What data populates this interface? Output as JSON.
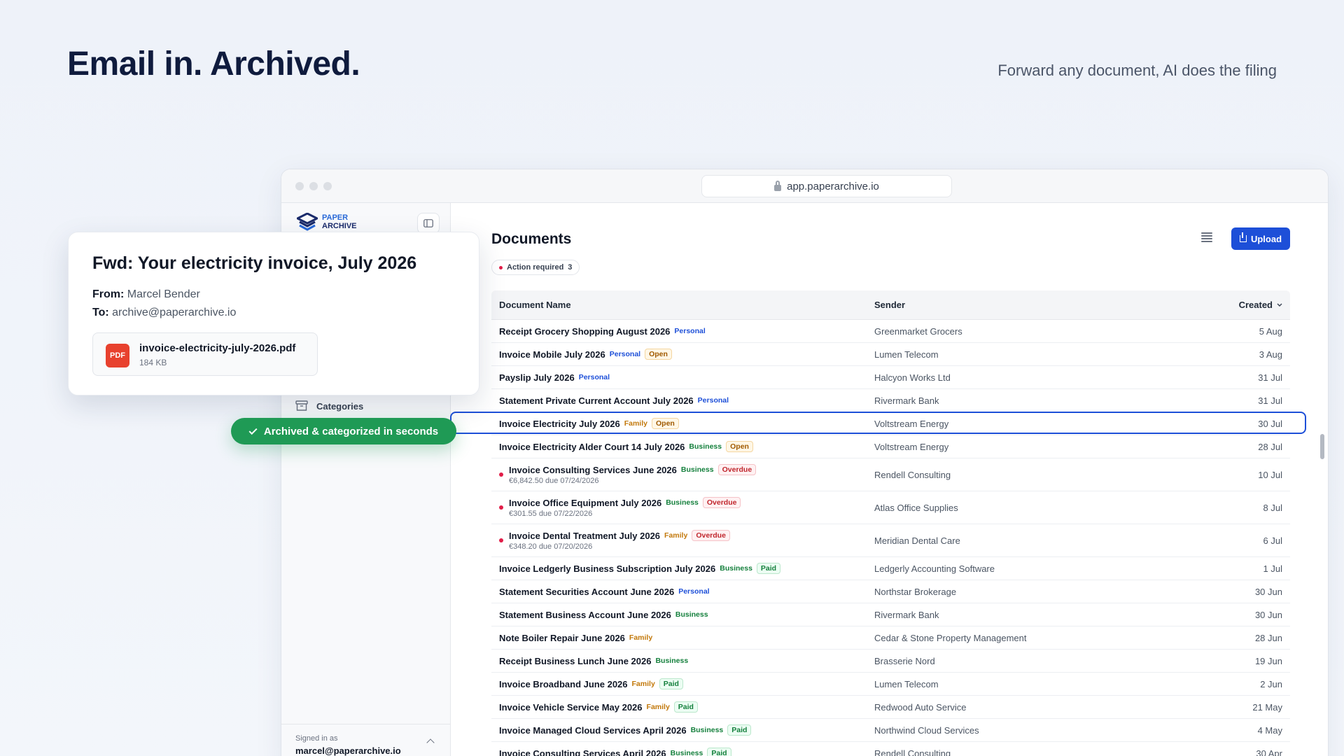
{
  "hero": {
    "title": "Email in. Archived.",
    "subtitle": "Forward any document, AI does the filing"
  },
  "browser": {
    "url": "app.paperarchive.io"
  },
  "sidebar": {
    "logo_line1": "PAPER",
    "logo_line2": "ARCHIVE",
    "categories_label": "Categories",
    "signed_label": "Signed in as",
    "signed_email": "marcel@paperarchive.io"
  },
  "main": {
    "title": "Documents",
    "action_required_label": "Action required",
    "action_required_count": "3",
    "upload_label": "Upload",
    "columns": {
      "name": "Document Name",
      "sender": "Sender",
      "created": "Created"
    }
  },
  "rows": [
    {
      "name": "Receipt Grocery Shopping August 2026",
      "tag": "Personal",
      "tagType": "personal",
      "status": "",
      "sender": "Greenmarket Grocers",
      "date": "5 Aug"
    },
    {
      "name": "Invoice Mobile July 2026",
      "tag": "Personal",
      "tagType": "personal",
      "status": "Open",
      "sender": "Lumen Telecom",
      "date": "3 Aug"
    },
    {
      "name": "Payslip July 2026",
      "tag": "Personal",
      "tagType": "personal",
      "status": "",
      "sender": "Halcyon Works Ltd",
      "date": "31 Jul"
    },
    {
      "name": "Statement Private Current Account July 2026",
      "tag": "Personal",
      "tagType": "personal",
      "status": "",
      "sender": "Rivermark Bank",
      "date": "31 Jul"
    },
    {
      "name": "Invoice Electricity July 2026",
      "tag": "Family",
      "tagType": "family",
      "status": "Open",
      "sender": "Voltstream Energy",
      "date": "30 Jul"
    },
    {
      "name": "Invoice Electricity Alder Court 14 July 2026",
      "tag": "Business",
      "tagType": "business",
      "status": "Open",
      "sender": "Voltstream Energy",
      "date": "28 Jul"
    },
    {
      "name": "Invoice Consulting Services June 2026",
      "tag": "Business",
      "tagType": "business",
      "status": "Overdue",
      "sub": "€6,842.50 due 07/24/2026",
      "sender": "Rendell Consulting",
      "date": "10 Jul"
    },
    {
      "name": "Invoice Office Equipment July 2026",
      "tag": "Business",
      "tagType": "business",
      "status": "Overdue",
      "sub": "€301.55 due 07/22/2026",
      "sender": "Atlas Office Supplies",
      "date": "8 Jul"
    },
    {
      "name": "Invoice Dental Treatment July 2026",
      "tag": "Family",
      "tagType": "family",
      "status": "Overdue",
      "sub": "€348.20 due 07/20/2026",
      "sender": "Meridian Dental Care",
      "date": "6 Jul"
    },
    {
      "name": "Invoice Ledgerly Business Subscription July 2026",
      "tag": "Business",
      "tagType": "business",
      "status": "Paid",
      "sender": "Ledgerly Accounting Software",
      "date": "1 Jul"
    },
    {
      "name": "Statement Securities Account June 2026",
      "tag": "Personal",
      "tagType": "personal",
      "status": "",
      "sender": "Northstar Brokerage",
      "date": "30 Jun"
    },
    {
      "name": "Statement Business Account June 2026",
      "tag": "Business",
      "tagType": "business",
      "status": "",
      "sender": "Rivermark Bank",
      "date": "30 Jun"
    },
    {
      "name": "Note Boiler Repair June 2026",
      "tag": "Family",
      "tagType": "family",
      "status": "",
      "sender": "Cedar & Stone Property Management",
      "date": "28 Jun"
    },
    {
      "name": "Receipt Business Lunch June 2026",
      "tag": "Business",
      "tagType": "business",
      "status": "",
      "sender": "Brasserie Nord",
      "date": "19 Jun"
    },
    {
      "name": "Invoice Broadband June 2026",
      "tag": "Family",
      "tagType": "family",
      "status": "Paid",
      "sender": "Lumen Telecom",
      "date": "2 Jun"
    },
    {
      "name": "Invoice Vehicle Service May 2026",
      "tag": "Family",
      "tagType": "family",
      "status": "Paid",
      "sender": "Redwood Auto Service",
      "date": "21 May"
    },
    {
      "name": "Invoice Managed Cloud Services April 2026",
      "tag": "Business",
      "tagType": "business",
      "status": "Paid",
      "sender": "Northwind Cloud Services",
      "date": "4 May"
    },
    {
      "name": "Invoice Consulting Services April 2026",
      "tag": "Business",
      "tagType": "business",
      "status": "Paid",
      "sender": "Rendell Consulting",
      "date": "30 Apr"
    }
  ],
  "email": {
    "subject": "Fwd: Your electricity invoice, July 2026",
    "from_label": "From:",
    "from_value": "Marcel Bender",
    "to_label": "To:",
    "to_value": "archive@paperarchive.io",
    "attachment_type": "PDF",
    "attachment_name": "invoice-electricity-july-2026.pdf",
    "attachment_size": "184 KB"
  },
  "toast": {
    "label": "Archived & categorized in seconds"
  },
  "colors": {
    "accent": "#1d4fd8",
    "success": "#1f9a55",
    "danger": "#e11d48"
  }
}
